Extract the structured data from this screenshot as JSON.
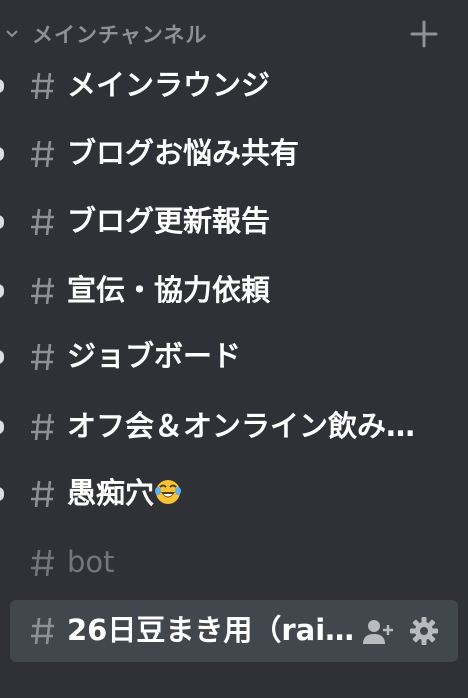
{
  "category": {
    "label": "メインチャンネル",
    "chevron_icon": "chevron-down-icon",
    "add_icon": "plus-icon",
    "text_color": "#8e9297"
  },
  "channels": [
    {
      "name": "メインラウンジ",
      "unread": true
    },
    {
      "name": "ブログお悩み共有",
      "unread": true
    },
    {
      "name": "ブログ更新報告",
      "unread": true
    },
    {
      "name": "宣伝・協力依頼",
      "unread": true
    },
    {
      "name": "ジョブボード",
      "unread": true
    },
    {
      "name": "オフ会＆オンライン飲み…",
      "unread": true
    },
    {
      "name": "愚痴穴",
      "unread": true,
      "emoji": "rolling-on-floor-laughing-emoji"
    },
    {
      "name": "bot",
      "unread": false
    },
    {
      "name": "26日豆まき用（rai…",
      "unread": false,
      "active": true,
      "actions": [
        "add-member-icon",
        "gear-icon"
      ]
    }
  ],
  "colors": {
    "background": "#2f3136",
    "active_background": "#42464d",
    "unread_text": "#ffffff",
    "muted_text": "#72767d",
    "icon": "#8e9297"
  }
}
